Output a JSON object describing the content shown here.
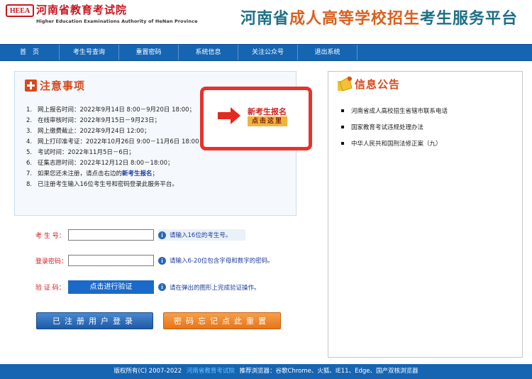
{
  "header": {
    "logo_mark": "HEEA",
    "logo_cn": "河南省教育考试院",
    "logo_en": "Higher Education Examinations Authority of HeNan Province",
    "title_a": "河南省",
    "title_b": "成人高等学校招生",
    "title_c": "考生服务平台"
  },
  "nav": {
    "items": [
      "首　页",
      "考生号查询",
      "重置密码",
      "系统信息",
      "关注公众号",
      "退出系统"
    ]
  },
  "notice": {
    "title": "注意事项",
    "items": [
      {
        "num": "1.",
        "text": "网上报名时间：2022年9月14日 8:00－9月20日 18:00；"
      },
      {
        "num": "2.",
        "text": "在线审核时间：2022年9月15日－9月23日；"
      },
      {
        "num": "3.",
        "text": "网上缴费截止：2022年9月24日 12:00；"
      },
      {
        "num": "4.",
        "text": "网上打印准考证：2022年10月26日 9:00－11月6日 18:00；"
      },
      {
        "num": "5.",
        "text": "考试时间：2022年11月5日－6日；"
      },
      {
        "num": "6.",
        "text": "征集志愿时间：2022年12月12日 8:00－18:00；"
      },
      {
        "num": "7.",
        "text_before": "如果您还未注册，请点击右边的",
        "link": "新考生报名",
        "text_after": "；"
      },
      {
        "num": "8.",
        "text": "已注册考生输入16位考生号和密码登录此服务平台。"
      }
    ]
  },
  "callout": {
    "label": "新考生报名",
    "button": "点击这里"
  },
  "info": {
    "title": "信息公告",
    "items": [
      "河南省成人高校招生省辖市联系电话",
      "国家教育考试违规处理办法",
      "中华人民共和国刑法修正案（九）"
    ]
  },
  "form": {
    "exam_no_label": "考 生 号：",
    "exam_no_value": "",
    "exam_no_hint": "请输入16位的考生号。",
    "password_label": "登录密码：",
    "password_value": "",
    "password_hint": "请输入6-20位包含字母和数字的密码。",
    "captcha_label": "验 证 码：",
    "captcha_button": "点击进行验证",
    "captcha_hint": "请在弹出的图形上完成验证操作。",
    "hint_icon": "i"
  },
  "buttons": {
    "login": "已注册用户登录",
    "reset": "密码忘记点此重置"
  },
  "footer": {
    "copyright": "版权所有(C) 2007-2022",
    "org": "河南省教育考试院",
    "browsers": "推荐浏览器：谷歌Chrome、火狐、IE11、Edge、国产双核浏览器"
  },
  "colors": {
    "nav_blue": "#1565b3",
    "accent_red": "#d0211c",
    "orange": "#e6741a"
  },
  "icons": [
    "plus-icon",
    "arrow-right-icon",
    "speaker-icon",
    "info-icon"
  ]
}
